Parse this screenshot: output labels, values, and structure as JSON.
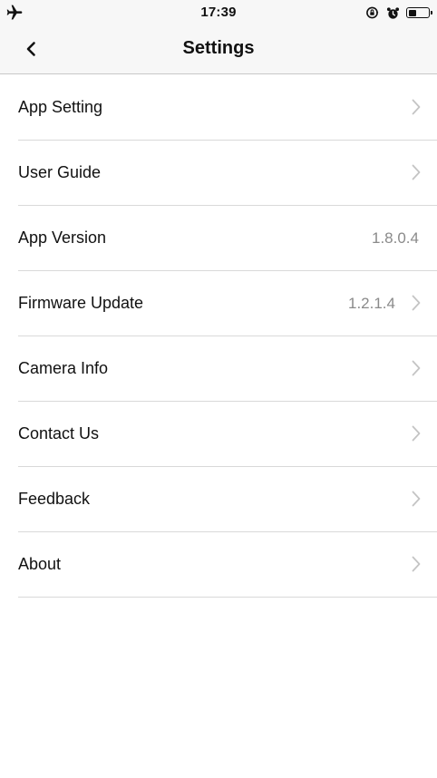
{
  "status_bar": {
    "time": "17:39",
    "icons": [
      "airplane-icon",
      "orientation-lock-icon",
      "alarm-icon",
      "battery-icon"
    ],
    "battery_level": 0.4
  },
  "nav": {
    "title": "Settings",
    "back_icon": "chevron-left-icon"
  },
  "rows": [
    {
      "label": "App Setting",
      "value": "",
      "chevron": true
    },
    {
      "label": "User Guide",
      "value": "",
      "chevron": true
    },
    {
      "label": "App Version",
      "value": "1.8.0.4",
      "chevron": false
    },
    {
      "label": "Firmware Update",
      "value": "1.2.1.4",
      "chevron": true
    },
    {
      "label": "Camera Info",
      "value": "",
      "chevron": true
    },
    {
      "label": "Contact Us",
      "value": "",
      "chevron": true
    },
    {
      "label": "Feedback",
      "value": "",
      "chevron": true
    },
    {
      "label": "About",
      "value": "",
      "chevron": true
    }
  ],
  "colors": {
    "bar_background": "#f7f7f7",
    "separator": "#d9d9d9",
    "value_text": "#8a8a8a",
    "chevron": "#c4c4c4"
  }
}
